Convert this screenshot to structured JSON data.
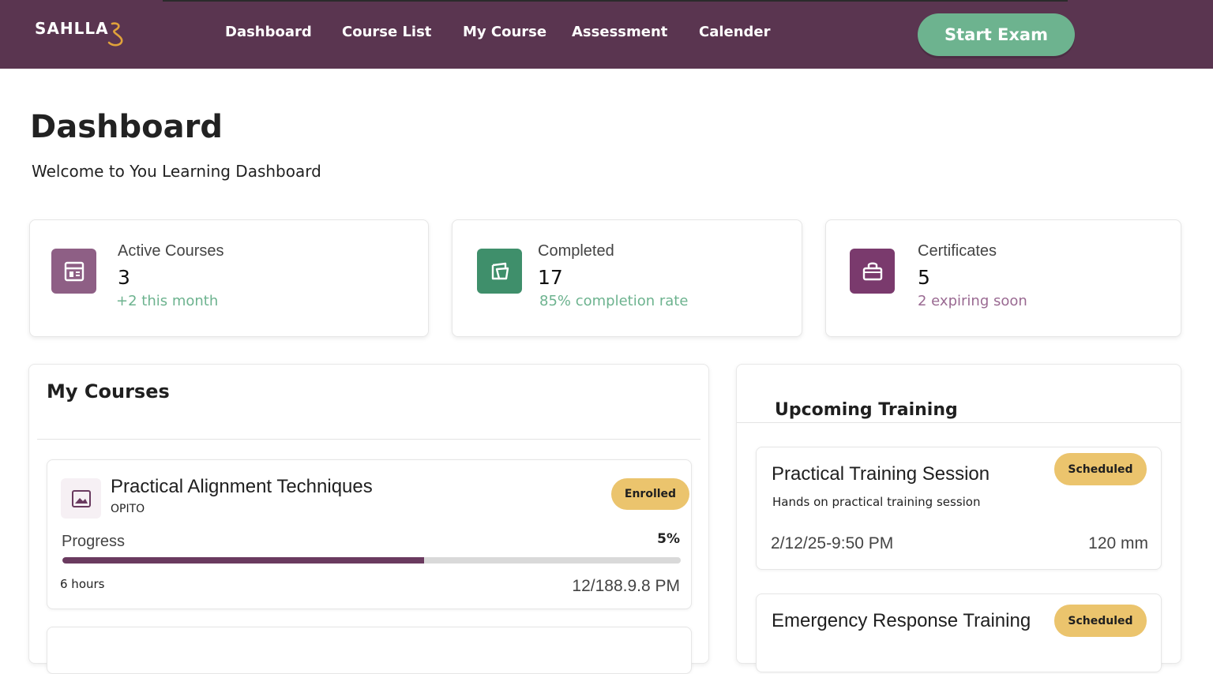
{
  "brand": {
    "logo_text": "SAHLLA"
  },
  "nav": {
    "items": [
      {
        "label": "Dashboard"
      },
      {
        "label": "Course List"
      },
      {
        "label": "My Course"
      },
      {
        "label": "Assessment"
      },
      {
        "label": "Calender"
      }
    ],
    "start_exam_label": "Start Exam"
  },
  "header": {
    "title": "Dashboard",
    "subtitle": "Welcome to You Learning Dashboard"
  },
  "stats": [
    {
      "label": "Active Courses",
      "value": "3",
      "sub": "+2 this month",
      "icon": "calendar-icon",
      "icon_color": "#8e5f85",
      "sub_color": "#6db38f"
    },
    {
      "label": "Completed",
      "value": "17",
      "sub": "85% completion rate",
      "icon": "book-check-icon",
      "icon_color": "#3f8f6b",
      "sub_color": "#6db38f"
    },
    {
      "label": "Certificates",
      "value": "5",
      "sub": "2 expiring soon",
      "icon": "bag-icon",
      "icon_color": "#7a3a6d",
      "sub_color": "#9a6a92"
    }
  ],
  "my_courses": {
    "title": "My Courses",
    "courses": [
      {
        "title": "Practical Alignment Techniques",
        "provider": "OPITO",
        "status": "Enrolled",
        "progress_label": "Progress",
        "progress_text": "5%",
        "progress_fill": 0.585,
        "duration": "6 hours",
        "date": "12/188.9.8 PM"
      }
    ]
  },
  "upcoming_training": {
    "title": "Upcoming Training",
    "sessions": [
      {
        "title": "Practical Training Session",
        "description": "Hands on practical training session",
        "status": "Scheduled",
        "datetime": "2/12/25-9:50 PM",
        "duration": "120 mm"
      },
      {
        "title": "Emergency Response Training",
        "status": "Scheduled"
      }
    ]
  },
  "colors": {
    "topbar": "#5a3550",
    "accent_green": "#6db38f",
    "badge_yellow": "#ebc46d",
    "progress_purple": "#6a3a5f"
  }
}
